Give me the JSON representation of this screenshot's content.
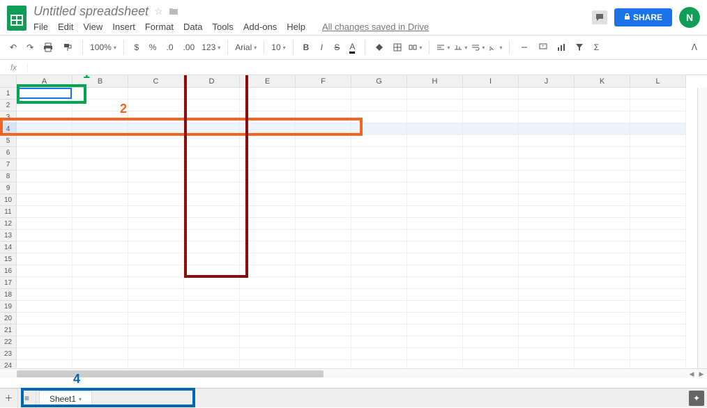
{
  "header": {
    "title": "Untitled spreadsheet",
    "menus": [
      "File",
      "Edit",
      "View",
      "Insert",
      "Format",
      "Data",
      "Tools",
      "Add-ons",
      "Help"
    ],
    "save_status": "All changes saved in Drive",
    "share_label": "SHARE",
    "avatar_letter": "N"
  },
  "toolbar": {
    "zoom": "100%",
    "currency_fmt": "$",
    "percent_fmt": "%",
    "dec_decrease": ".0",
    "dec_increase": ".00",
    "more_formats": "123",
    "font_name": "Arial",
    "font_size": "10"
  },
  "formula_bar": {
    "fx_label": "fx"
  },
  "grid": {
    "columns": [
      "A",
      "B",
      "C",
      "D",
      "E",
      "F",
      "G",
      "H",
      "I",
      "J",
      "K",
      "L"
    ],
    "rows": 25,
    "selected_row": 4,
    "active_cell": "A1"
  },
  "sheets": {
    "active": "Sheet1"
  },
  "annotations": {
    "1": {
      "color": "#00a651"
    },
    "2": {
      "color": "#f26522"
    },
    "3": {
      "color": "#8b0c0c"
    },
    "4": {
      "color": "#0066b3"
    }
  }
}
